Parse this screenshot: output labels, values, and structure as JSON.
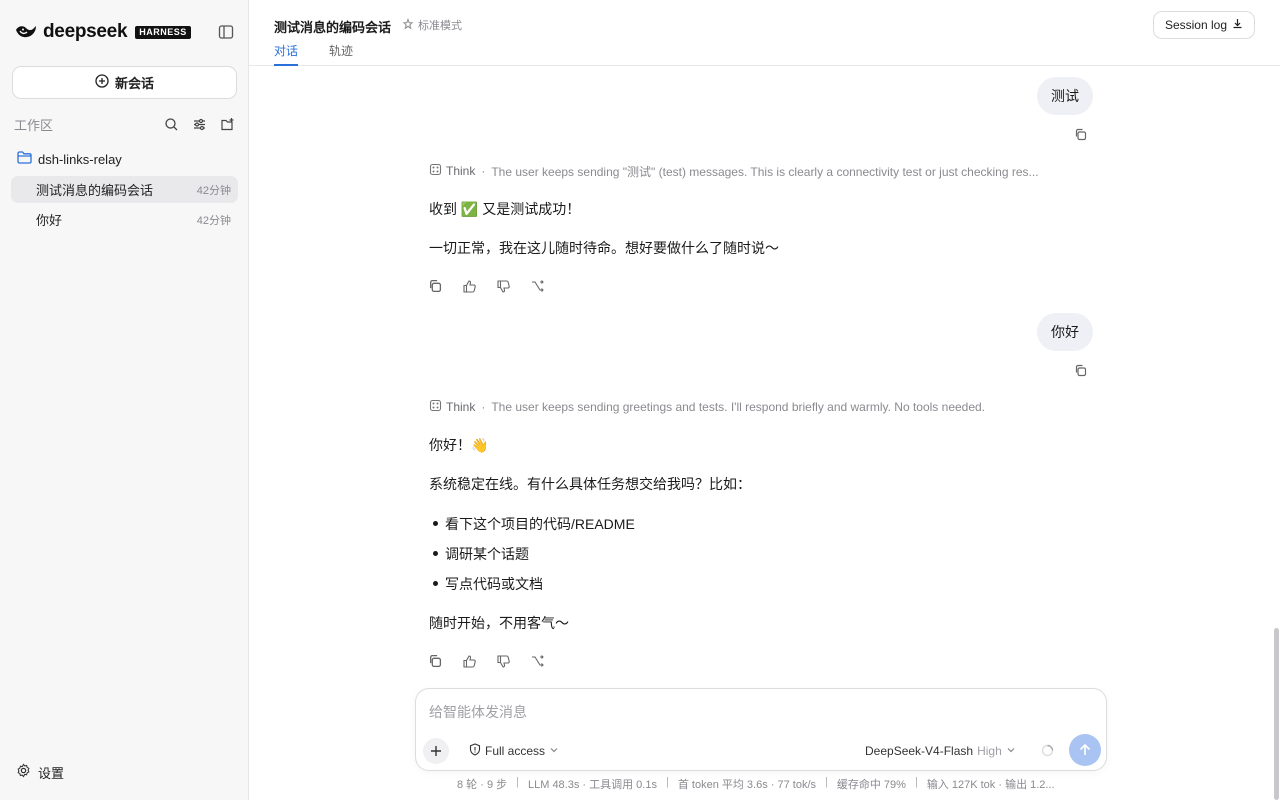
{
  "sidebar": {
    "brand_name": "deepseek",
    "brand_badge": "HARNESS",
    "new_chat_label": "新会话",
    "workspace_title": "工作区",
    "folder_name": "dsh-links-relay",
    "sessions": [
      {
        "title": "测试消息的编码会话",
        "time": "42分钟",
        "active": true
      },
      {
        "title": "你好",
        "time": "42分钟",
        "active": false
      }
    ],
    "settings_label": "设置"
  },
  "header": {
    "title": "测试消息的编码会话",
    "mode": "标准模式",
    "tabs": [
      {
        "label": "对话",
        "active": true
      },
      {
        "label": "轨迹",
        "active": false
      }
    ],
    "session_log_label": "Session log"
  },
  "conversation": {
    "think_label": "Think",
    "turns": [
      {
        "user": "测试",
        "think": "The user keeps sending \"测试\" (test) messages. This is clearly a connectivity test or just checking res...",
        "paragraphs": [
          "收到 ✅ 又是测试成功！",
          "一切正常，我在这儿随时待命。想好要做什么了随时说～"
        ]
      },
      {
        "user": "你好",
        "think": "The user keeps sending greetings and tests. I'll respond briefly and warmly. No tools needed.",
        "greeting": "你好！👋",
        "intro": "系统稳定在线。有什么具体任务想交给我吗？比如：",
        "bullets": [
          "看下这个项目的代码/README",
          "调研某个话题",
          "写点代码或文档"
        ],
        "closing": "随时开始，不用客气～"
      }
    ]
  },
  "composer": {
    "placeholder": "给智能体发消息",
    "access_label": "Full access",
    "model_name": "DeepSeek-V4-Flash",
    "model_level": "High"
  },
  "stats": [
    "8 轮 · 9 步",
    "LLM 48.3s · 工具调用 0.1s",
    "首 token 平均 3.6s · 77 tok/s",
    "缓存命中 79%",
    "输入 127K tok · 输出 1.2..."
  ],
  "colors": {
    "accent": "#2b6fd8",
    "send_button": "#a9c3f2",
    "user_bubble": "#eef0f5",
    "sidebar_bg": "#f7f7f8"
  }
}
